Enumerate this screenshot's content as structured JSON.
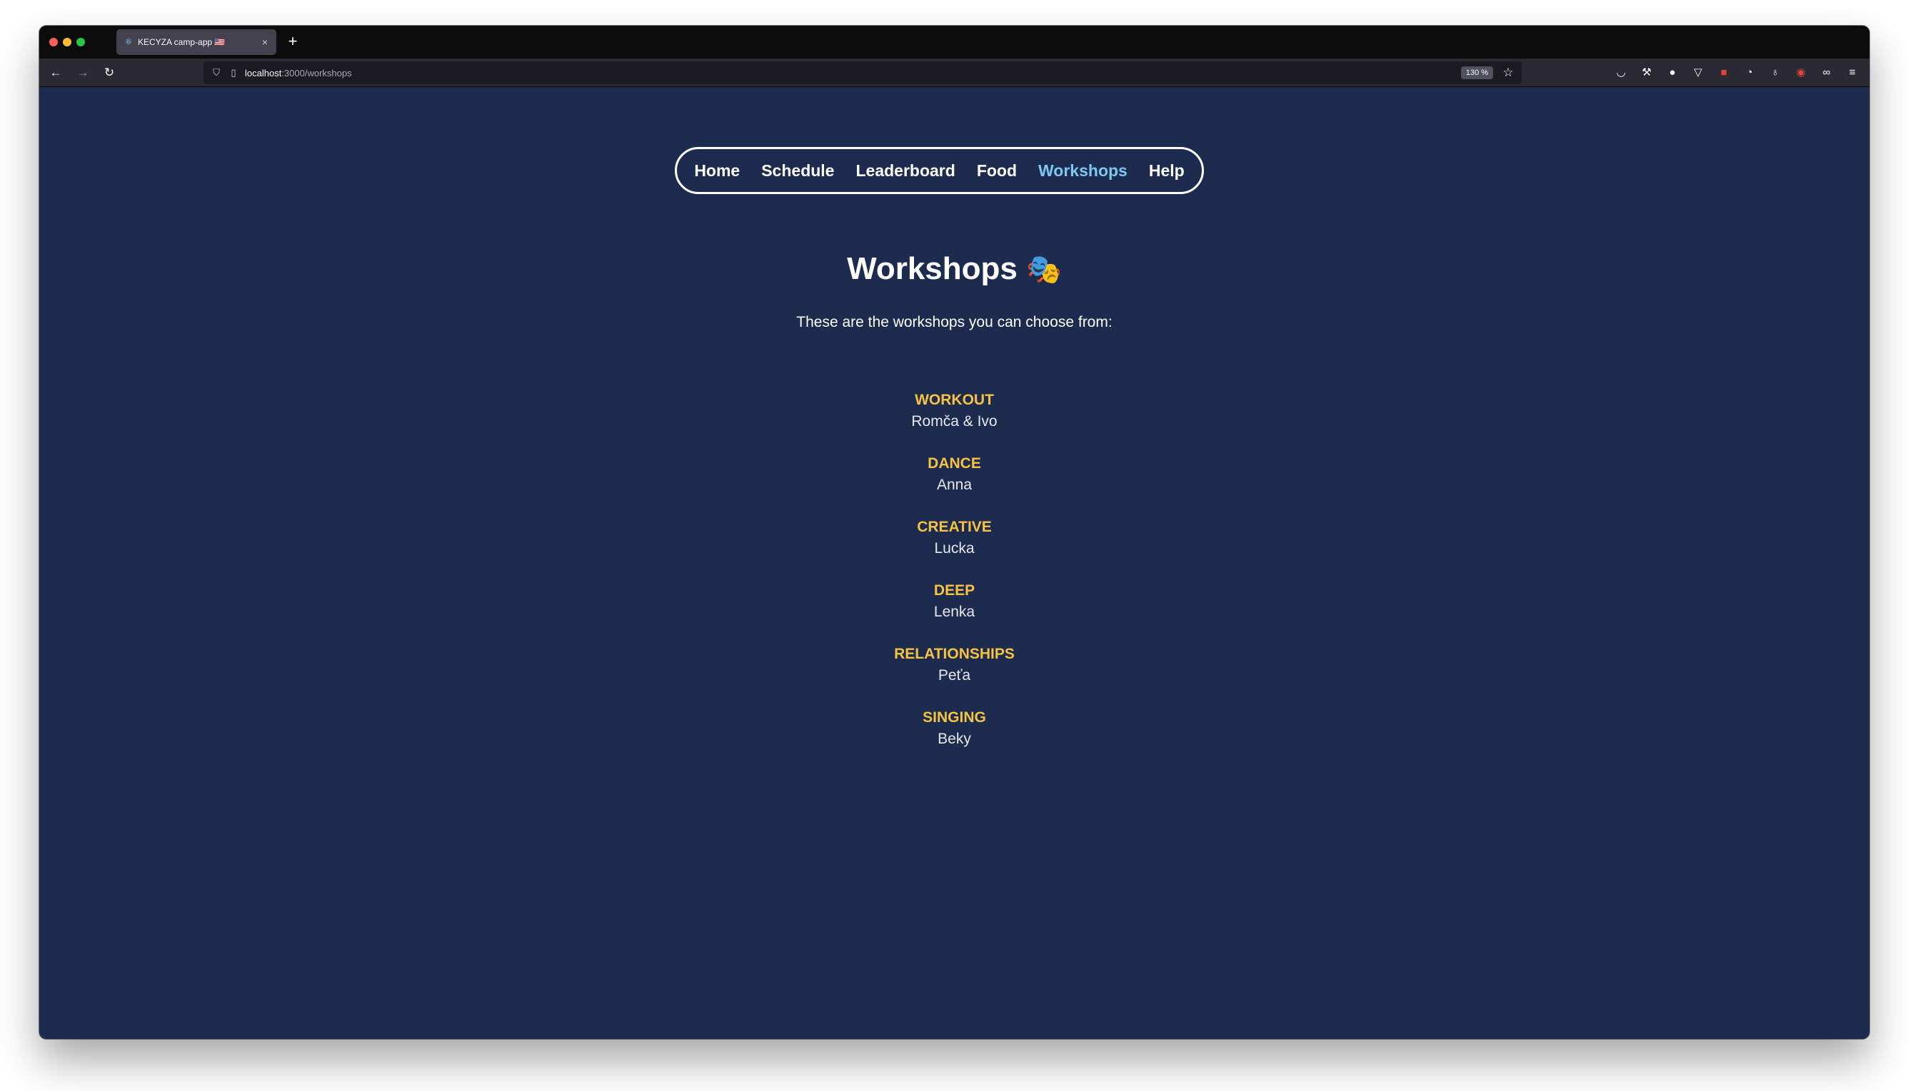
{
  "browser": {
    "tab_title": "KECYZA camp-app 🇺🇸",
    "tab_close": "×",
    "new_tab": "+",
    "url_host": "localhost",
    "url_path": ":3000/workshops",
    "zoom": "130 %"
  },
  "nav": {
    "items": [
      {
        "label": "Home"
      },
      {
        "label": "Schedule"
      },
      {
        "label": "Leaderboard"
      },
      {
        "label": "Food"
      },
      {
        "label": "Workshops",
        "active": true
      },
      {
        "label": "Help"
      }
    ],
    "active_color": "#7ec8f0"
  },
  "page": {
    "title": "Workshops",
    "title_emoji": "🎭",
    "intro": "These are the workshops you can choose from:"
  },
  "workshops": [
    {
      "name": "WORKOUT",
      "leader": "Romča & Ivo"
    },
    {
      "name": "DANCE",
      "leader": "Anna"
    },
    {
      "name": "CREATIVE",
      "leader": "Lucka"
    },
    {
      "name": "DEEP",
      "leader": "Lenka"
    },
    {
      "name": "RELATIONSHIPS",
      "leader": "Peťa"
    },
    {
      "name": "SINGING",
      "leader": "Beky"
    }
  ],
  "colors": {
    "background": "#1d2b4f",
    "workshop_name": "#f5c242",
    "text": "#ffffff"
  }
}
